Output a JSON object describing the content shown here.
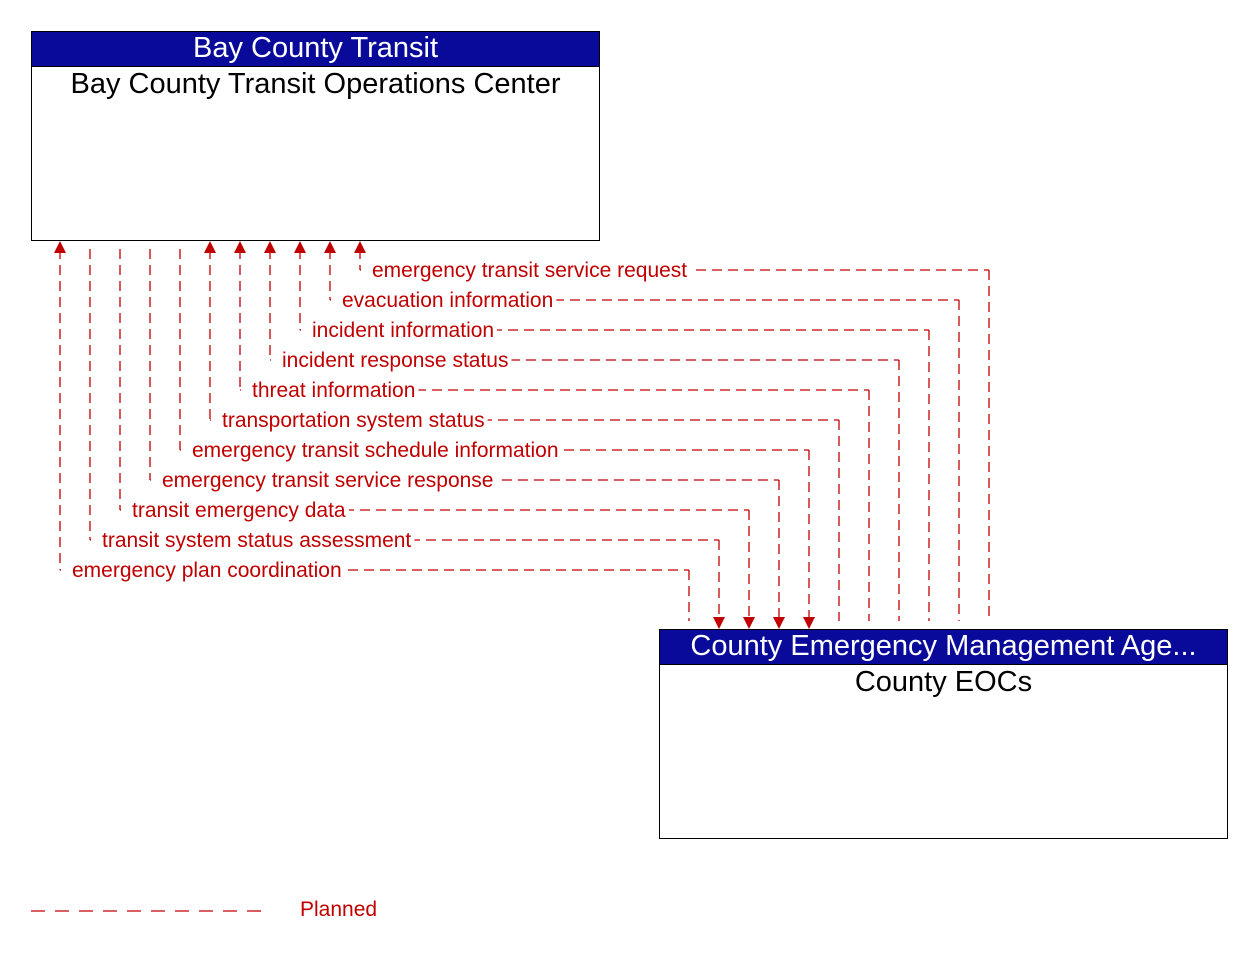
{
  "nodes": {
    "source": {
      "owner": "Bay County Transit",
      "name": "Bay County Transit Operations Center"
    },
    "target": {
      "owner": "County Emergency Management Age...",
      "name": "County EOCs"
    }
  },
  "flows": [
    {
      "label": "emergency transit service request",
      "direction": "to-source",
      "status": "Planned"
    },
    {
      "label": "evacuation information",
      "direction": "to-source",
      "status": "Planned"
    },
    {
      "label": "incident information",
      "direction": "to-source",
      "status": "Planned"
    },
    {
      "label": "incident response status",
      "direction": "to-source",
      "status": "Planned"
    },
    {
      "label": "threat information",
      "direction": "to-source",
      "status": "Planned"
    },
    {
      "label": "transportation system status",
      "direction": "to-source",
      "status": "Planned"
    },
    {
      "label": "emergency transit schedule information",
      "direction": "to-target",
      "status": "Planned"
    },
    {
      "label": "emergency transit service response",
      "direction": "to-target",
      "status": "Planned"
    },
    {
      "label": "transit emergency data",
      "direction": "to-target",
      "status": "Planned"
    },
    {
      "label": "transit system status assessment",
      "direction": "to-target",
      "status": "Planned"
    },
    {
      "label": "emergency plan coordination",
      "direction": "to-source",
      "status": "Planned"
    }
  ],
  "legend": {
    "label": "Planned",
    "color": "#c00000"
  },
  "colors": {
    "header": "#0a0a9a",
    "flow": "#c00000"
  }
}
